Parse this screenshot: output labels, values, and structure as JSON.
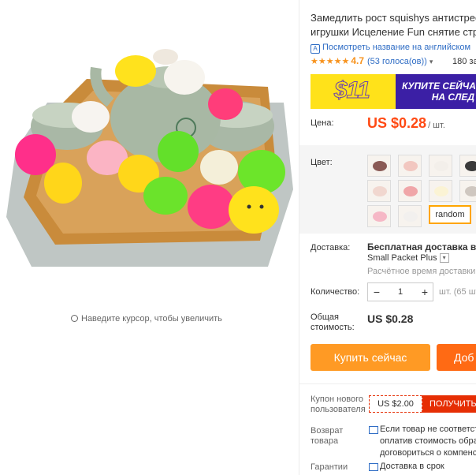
{
  "product": {
    "title_line1": "Замедлить рост squishys антистрес",
    "title_line2": "игрушки Исцеление Fun снятие стр",
    "translate_link": "Посмотреть название на английском",
    "rating_stars": "★★★★★",
    "rating_value": "4.7",
    "rating_count": "(53 голоса(ов))",
    "orders": "180 за"
  },
  "banner": {
    "price": "$11",
    "text_line1": "КУПИТЕ СЕЙЧА",
    "text_line2": "НА СЛЕД"
  },
  "gallery": {
    "zoom_hint": "Наведите курсор, чтобы увеличить"
  },
  "price": {
    "label": "Цена:",
    "value": "US $0.28",
    "unit": "/ шт."
  },
  "color": {
    "label": "Цвет:",
    "random_label": "random",
    "swatch_colors": [
      "#8a5a55",
      "#f2c7c0",
      "#f3efea",
      "#3a3a3a",
      "#f1d7cf",
      "#f0a6a8",
      "#fbf3d4",
      "#cfc7c0",
      "#f6b8c6",
      "#f2f0ee"
    ]
  },
  "shipping": {
    "label": "Доставка:",
    "title": "Бесплатная доставка в Rus",
    "method": "Small Packet Plus",
    "time": "Расчётное время доставки: "
  },
  "quantity": {
    "label": "Количество:",
    "minus": "−",
    "value": "1",
    "plus": "+",
    "available": "шт. (65 шт"
  },
  "total": {
    "label_line1": "Общая",
    "label_line2": "стоимость:",
    "value": "US $0.28"
  },
  "actions": {
    "buy_now": "Купить сейчас",
    "add_cart": "Доб"
  },
  "coupon": {
    "label_line1": "Купон нового",
    "label_line2": "пользователя",
    "value": "US $2.00",
    "button": "ПОЛУЧИТЬ"
  },
  "return": {
    "label_line1": "Возврат",
    "label_line2": "товара",
    "line1": "Если товар не соответствует",
    "line2": "оплатив стоимость обрат",
    "line3": "договориться о компенса"
  },
  "guarantee": {
    "label": "Гарантии",
    "text": "Доставка в срок"
  }
}
